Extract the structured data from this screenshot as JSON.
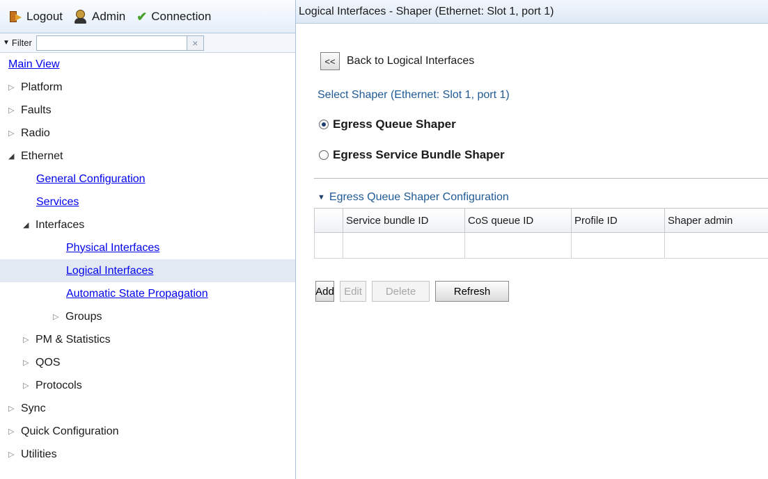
{
  "topbar": {
    "logout_label": "Logout",
    "admin_label": "Admin",
    "connection_label": "Connection",
    "connection_color": "#48a02a"
  },
  "filter": {
    "label": "Filter",
    "value": "",
    "placeholder": "",
    "clear_icon": "×"
  },
  "tree": {
    "main_view": "Main View",
    "platform": "Platform",
    "faults": "Faults",
    "radio": "Radio",
    "ethernet": "Ethernet",
    "general_configuration": "General Configuration",
    "services": "Services",
    "interfaces": "Interfaces",
    "physical_interfaces": "Physical Interfaces",
    "logical_interfaces": "Logical Interfaces",
    "automatic_state_propagation": "Automatic State Propagation",
    "groups": "Groups",
    "pm_statistics": "PM & Statistics",
    "qos": "QOS",
    "protocols": "Protocols",
    "sync": "Sync",
    "quick_configuration": "Quick Configuration",
    "utilities": "Utilities"
  },
  "main": {
    "title": "Logical Interfaces - Shaper (Ethernet: Slot 1, port 1)",
    "back_button": "<<",
    "back_label": "Back to Logical Interfaces",
    "select_title": "Select Shaper (Ethernet: Slot 1, port 1)",
    "radio_queue": "Egress Queue Shaper",
    "radio_bundle": "Egress Service Bundle Shaper",
    "section_title": "Egress Queue Shaper Configuration",
    "columns": [
      "",
      "Service bundle ID",
      "CoS queue ID",
      "Profile ID",
      "Shaper admin"
    ],
    "buttons": {
      "add": "Add",
      "edit": "Edit",
      "delete": "Delete",
      "refresh": "Refresh"
    }
  }
}
